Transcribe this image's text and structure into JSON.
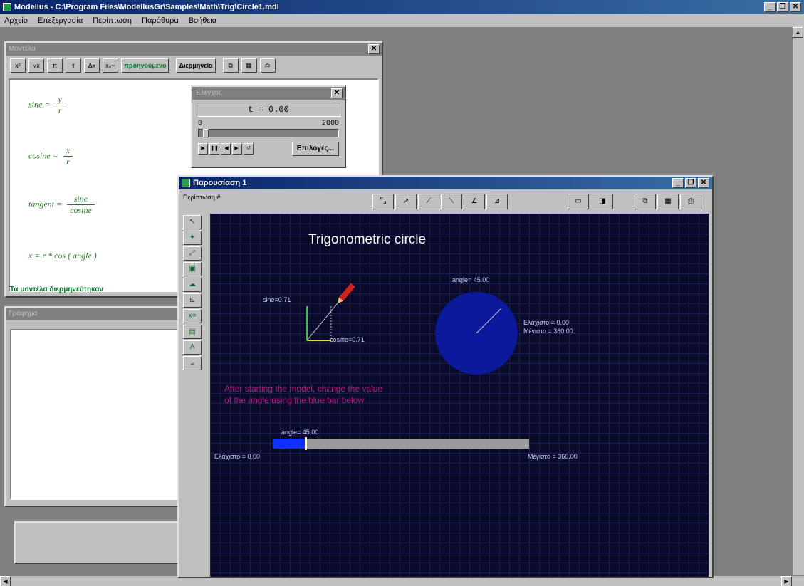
{
  "app": {
    "title": "Modellus - C:\\Program Files\\ModellusGr\\Samples\\Math\\Trig\\Circle1.mdl",
    "window_buttons": [
      "_",
      "❐",
      "✕"
    ]
  },
  "menu": [
    "Αρχείο",
    "Επεξεργασία",
    "Περίπτωση",
    "Παράθυρα",
    "Βοήθεια"
  ],
  "model_window": {
    "title": "Μοντέλο",
    "toolbar": [
      "x²",
      "√x",
      "π",
      "τ",
      "Δx",
      "x₀~",
      "προηγούμενο",
      "Διερμηνεία"
    ],
    "equations": [
      {
        "lhs": "sine",
        "num": "y",
        "den": "r"
      },
      {
        "lhs": "cosine",
        "num": "x",
        "den": "r"
      },
      {
        "lhs": "tangent",
        "num": "sine",
        "den": "cosine"
      }
    ],
    "equation4": "x = r * cos ( angle )",
    "status": "Τα μοντέλα διερμηνεύτηκαν"
  },
  "control": {
    "title": "Έλεγχος",
    "t_readout": "t = 0.00",
    "slider_min": "0",
    "slider_max": "2000",
    "options_label": "Επιλογές..."
  },
  "graph_window": {
    "title": "Γράφημα"
  },
  "presentation": {
    "title": "Παρουσίαση 1",
    "page_label": "Περίπτωση #",
    "canvas_title": "Trigonometric circle",
    "sine_label": "sine=0.71",
    "cosine_label": "cosine=0.71",
    "angle_pie_label": "angle= 45.00",
    "pie_min_label": "Ελάχιστο = 0.00",
    "pie_max_label": "Μέγιστο = 360.00",
    "instruction_line1": "After starting the model, change the value",
    "instruction_line2": "of the angle using the blue bar below",
    "bar_angle_label": "angle= 45.00",
    "bar_min_label": "Ελάχιστο = 0.00",
    "bar_max_label": "Μέγιστο = 360.00",
    "angle_value": 45,
    "angle_max": 360,
    "colors": {
      "canvas": "#0a0a2a",
      "pie": "#0a1a9a",
      "bar_fill": "#1030ff",
      "instruction": "#b02080"
    }
  }
}
